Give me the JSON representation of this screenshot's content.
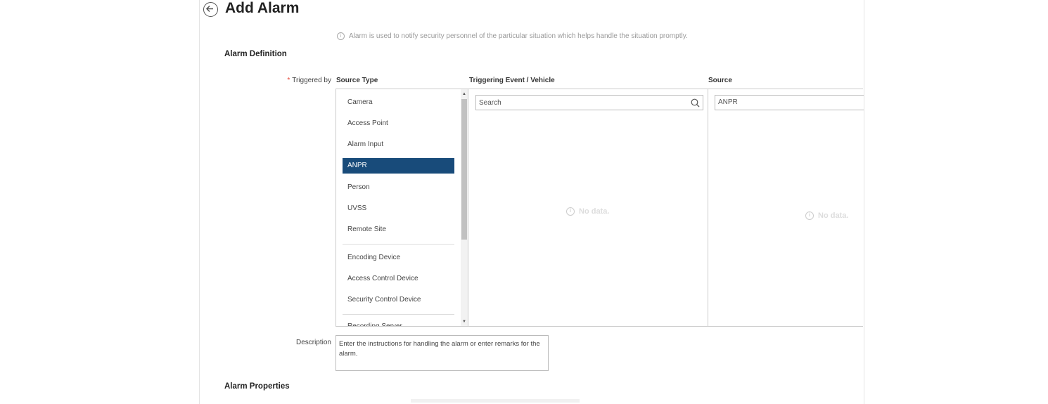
{
  "header": {
    "title": "Add Alarm",
    "notice": "Alarm is used to notify security personnel of the particular situation which helps handle the situation promptly."
  },
  "sections": {
    "definition": "Alarm Definition",
    "properties": "Alarm Properties"
  },
  "form": {
    "triggered_by_label": "Triggered by",
    "required_mark": "*",
    "description_label": "Description",
    "description_placeholder": "Enter the instructions for handling the alarm or enter remarks for the alarm."
  },
  "columns": {
    "source_type": "Source Type",
    "triggering_event": "Triggering Event / Vehicle",
    "source": "Source"
  },
  "source_types": [
    "Camera",
    "Access Point",
    "Alarm Input",
    "ANPR",
    "Person",
    "UVSS",
    "Remote Site",
    "Encoding Device",
    "Access Control Device",
    "Security Control Device",
    "Recording Server"
  ],
  "selected_source_type": "ANPR",
  "search": {
    "placeholder": "Search"
  },
  "source_field_value": "ANPR",
  "empty_text": "No data.",
  "colors": {
    "accent": "#184b7a",
    "required": "#e64b3c"
  }
}
